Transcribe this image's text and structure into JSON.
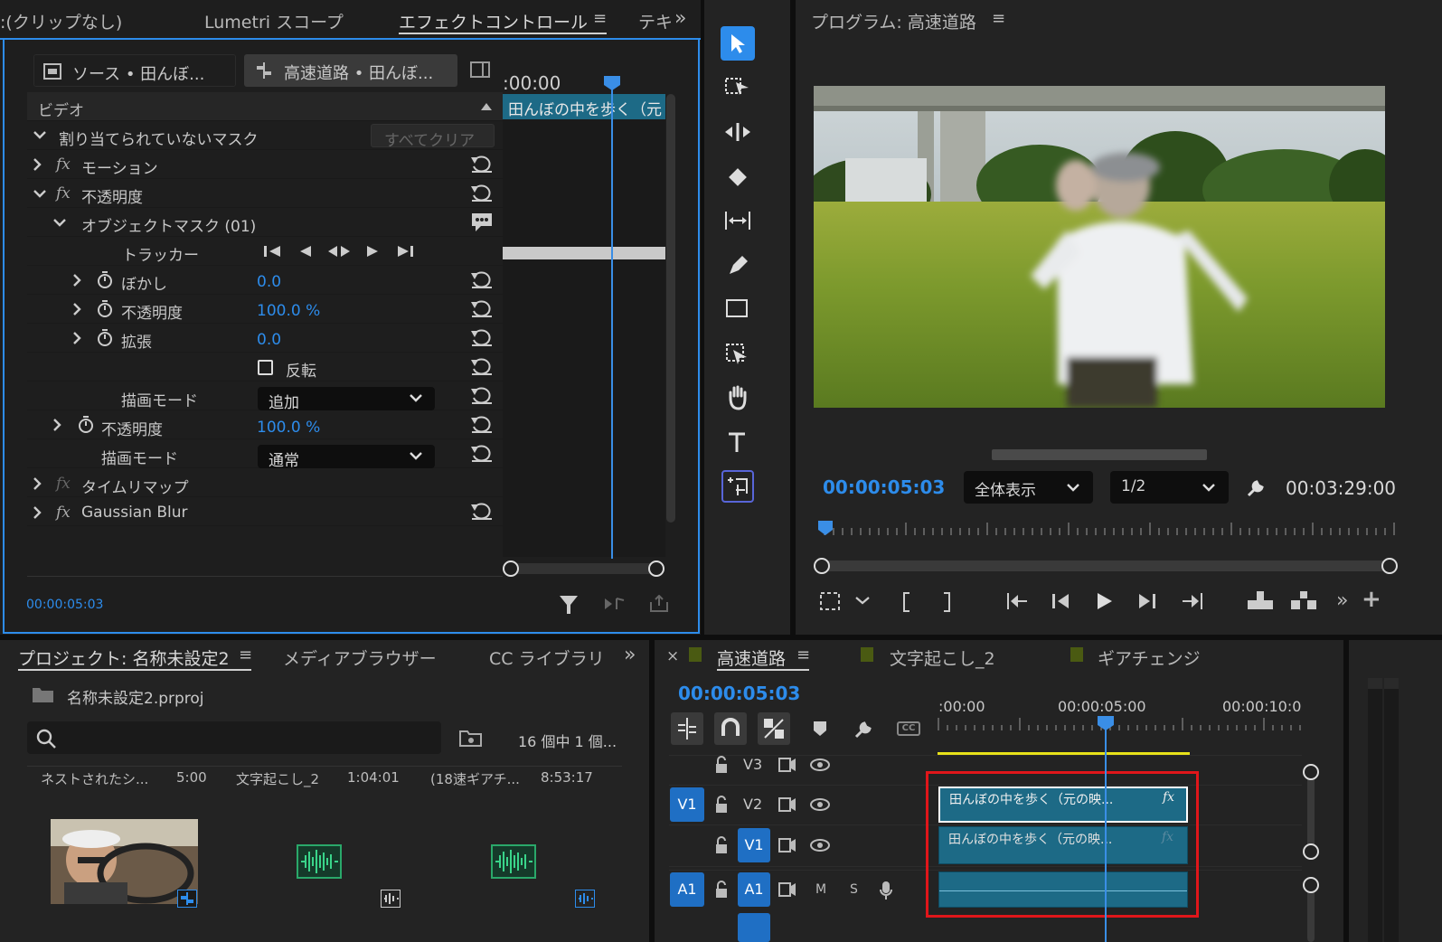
{
  "effect_panel": {
    "tabs": [
      ":(クリップなし)",
      "Lumetri スコープ",
      "エフェクトコントロール",
      "テキ"
    ],
    "overflow": "»",
    "source_tab": "ソース • 田んぼ...",
    "seq_tab": "高速道路 • 田んぼ...",
    "timecode_top": ":00:00",
    "clip_label": "田んぼの中を歩く（元",
    "section": "ビデオ",
    "mask_row": "割り当てられていないマスク",
    "clear_all": "すべてクリア",
    "fx_motion": "モーション",
    "fx_opacity": "不透明度",
    "object_mask": "オブジェクトマスク (01)",
    "tracker": "トラッカー",
    "blur_label": "ぼかし",
    "blur_value": "0.0",
    "mask_opacity_label": "不透明度",
    "mask_opacity_value": "100.0 %",
    "expand_label": "拡張",
    "expand_value": "0.0",
    "invert_label": "反転",
    "blend_label": "描画モード",
    "blend_value": "追加",
    "opacity_label": "不透明度",
    "opacity_value": "100.0 %",
    "blend2_label": "描画モード",
    "blend2_value": "通常",
    "fx_remap": "タイムリマップ",
    "fx_blur": "Gaussian Blur",
    "fx_symbol": "fx",
    "timecode_bottom": "00:00:05:03"
  },
  "program": {
    "title": "プログラム: 高速道路",
    "timecode": "00:00:05:03",
    "zoom": "全体表示",
    "resolution": "1/2",
    "duration": "00:03:29:00"
  },
  "project": {
    "tabs": [
      "プロジェクト: 名称未設定2",
      "メディアブラウザー",
      "CC ライブラリ"
    ],
    "file": "名称未設定2.prproj",
    "count": "16 個中 1 個...",
    "items": [
      {
        "name": "ネストされたシ...",
        "dur": "5:00"
      },
      {
        "name": "文字起こし_2",
        "dur": "1:04:01"
      },
      {
        "name": "(18速ギアチ...",
        "dur": "8:53:17"
      }
    ]
  },
  "timeline": {
    "close": "×",
    "tabs": [
      "高速道路",
      "文字起こし_2",
      "ギアチェンジ"
    ],
    "timecode": "00:00:05:03",
    "ruler": [
      ":00:00",
      "00:00:05:00",
      "00:00:10:0"
    ],
    "tracks": {
      "v3": "V3",
      "v2": "V2",
      "v1": "V1",
      "a1": "A1",
      "m": "M",
      "s": "S",
      "src_v1": "V1",
      "src_a1": "A1"
    },
    "clip_v2": "田んぼの中を歩く（元の映...",
    "clip_v1": "田んぼの中を歩く（元の映...",
    "fx": "fx"
  },
  "colors": {
    "accent": "#2d8ceb",
    "clip": "#1d6a86",
    "highlight": "#e0161a",
    "panel": "#232323"
  }
}
